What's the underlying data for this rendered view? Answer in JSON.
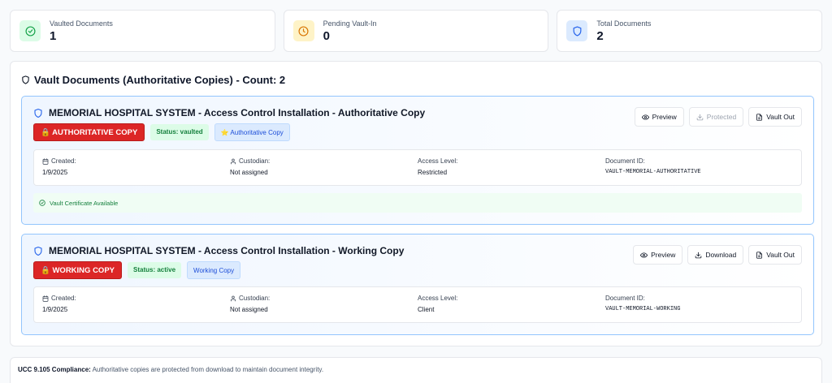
{
  "stats": [
    {
      "label": "Vaulted Documents",
      "value": "1",
      "icon": "check-circle-icon",
      "color": "#16a34a"
    },
    {
      "label": "Pending Vault-In",
      "value": "0",
      "icon": "clock-icon",
      "color": "#d97706"
    },
    {
      "label": "Total Documents",
      "value": "2",
      "icon": "shield-icon",
      "color": "#2563eb"
    }
  ],
  "vault": {
    "title": "Vault Documents (Authoritative Copies) - Count: 2",
    "documents": [
      {
        "title": "MEMORIAL HOSPITAL SYSTEM - Access Control Installation - Authoritative Copy",
        "copy_badge": "🔒 AUTHORITATIVE COPY",
        "status": "Status: vaulted",
        "type_badge": "⭐ Authoritative Copy",
        "actions": {
          "preview": "Preview",
          "download": "Protected",
          "vault_out": "Vault Out"
        },
        "meta": {
          "created_label": "Created:",
          "created": "1/9/2025",
          "custodian_label": "Custodian:",
          "custodian": "Not assigned",
          "access_label": "Access Level:",
          "access": "Restricted",
          "docid_label": "Document ID:",
          "docid": "VAULT-MEMORIAL-AUTHORITATIVE"
        },
        "certificate": "Vault Certificate Available"
      },
      {
        "title": "MEMORIAL HOSPITAL SYSTEM - Access Control Installation - Working Copy",
        "copy_badge": "🔒 WORKING COPY",
        "status": "Status: active",
        "type_badge": "Working Copy",
        "actions": {
          "preview": "Preview",
          "download": "Download",
          "vault_out": "Vault Out"
        },
        "meta": {
          "created_label": "Created:",
          "created": "1/9/2025",
          "custodian_label": "Custodian:",
          "custodian": "Not assigned",
          "access_label": "Access Level:",
          "access": "Client",
          "docid_label": "Document ID:",
          "docid": "VAULT-MEMORIAL-WORKING"
        }
      }
    ]
  },
  "footer": {
    "label": "UCC 9.105 Compliance:",
    "text": "Authoritative copies are protected from download to maintain document integrity."
  },
  "colors": {
    "accent": "#2563eb",
    "danger": "#dc2626",
    "success": "#16a34a",
    "warning": "#d97706"
  }
}
